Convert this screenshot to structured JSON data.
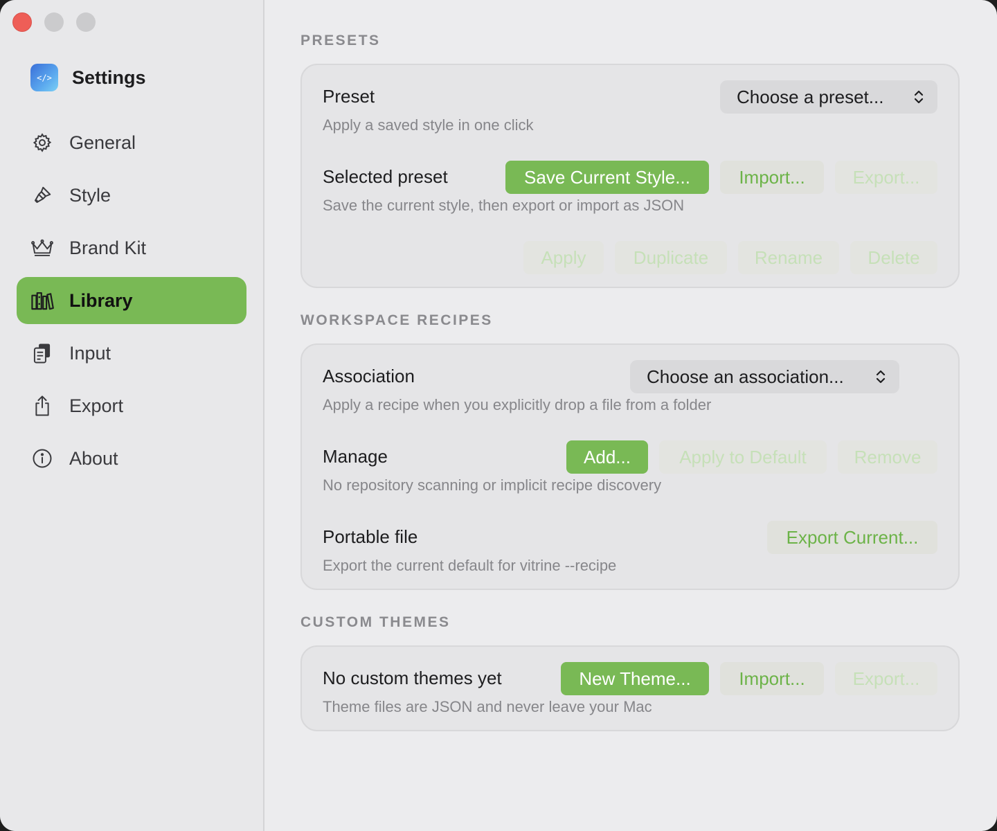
{
  "app": {
    "title": "Settings",
    "icon": "code-brackets-icon"
  },
  "sidebar": {
    "items": [
      {
        "label": "General",
        "icon": "gear-icon",
        "active": false
      },
      {
        "label": "Style",
        "icon": "paintbrush-icon",
        "active": false
      },
      {
        "label": "Brand Kit",
        "icon": "crown-icon",
        "active": false
      },
      {
        "label": "Library",
        "icon": "books-icon",
        "active": true
      },
      {
        "label": "Input",
        "icon": "document-stack-icon",
        "active": false
      },
      {
        "label": "Export",
        "icon": "share-icon",
        "active": false
      },
      {
        "label": "About",
        "icon": "info-icon",
        "active": false
      }
    ]
  },
  "presets": {
    "section_title": "PRESETS",
    "preset_label": "Preset",
    "preset_select": "Choose a preset...",
    "preset_desc": "Apply a saved style in one click",
    "selected_label": "Selected preset",
    "save_btn": "Save Current Style...",
    "import_btn": "Import...",
    "export_btn": "Export...",
    "selected_desc": "Save the current style, then export or import as JSON",
    "apply_btn": "Apply",
    "duplicate_btn": "Duplicate",
    "rename_btn": "Rename",
    "delete_btn": "Delete"
  },
  "recipes": {
    "section_title": "WORKSPACE RECIPES",
    "association_label": "Association",
    "association_select": "Choose an association...",
    "association_desc": "Apply a recipe when you explicitly drop a file from a folder",
    "manage_label": "Manage",
    "add_btn": "Add...",
    "apply_default_btn": "Apply to Default",
    "remove_btn": "Remove",
    "manage_desc": "No repository scanning or implicit recipe discovery",
    "portable_label": "Portable file",
    "export_current_btn": "Export Current...",
    "portable_desc": "Export the current default for vitrine --recipe"
  },
  "themes": {
    "section_title": "CUSTOM THEMES",
    "empty_label": "No custom themes yet",
    "new_btn": "New Theme...",
    "import_btn": "Import...",
    "export_btn": "Export...",
    "desc": "Theme files are JSON and never leave your Mac"
  },
  "colors": {
    "accent": "#79b955",
    "accent_text": "#6cb348",
    "disabled_text": "#c6e0b8"
  }
}
